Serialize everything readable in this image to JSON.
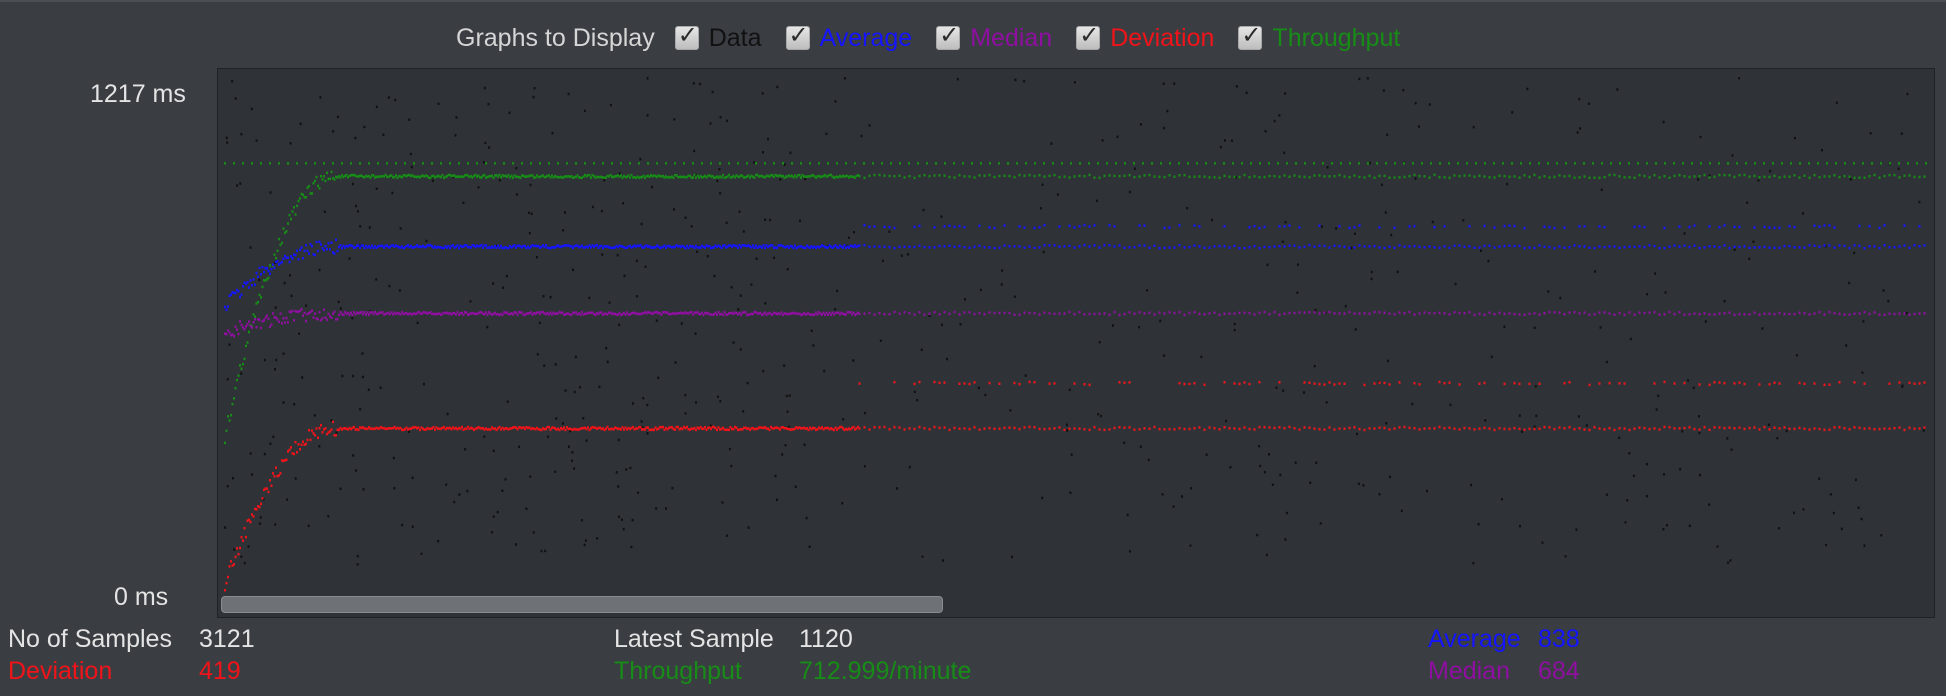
{
  "controls": {
    "title": "Graphs to Display",
    "checkboxes": [
      {
        "label": "Data",
        "checked": true,
        "color": "#111111"
      },
      {
        "label": "Average",
        "checked": true,
        "color": "#1414ff"
      },
      {
        "label": "Median",
        "checked": true,
        "color": "#8e0fa0"
      },
      {
        "label": "Deviation",
        "checked": true,
        "color": "#f0141a"
      },
      {
        "label": "Throughput",
        "checked": true,
        "color": "#178c17"
      }
    ]
  },
  "y_axis": {
    "max_label": "1217  ms",
    "min_label": "0  ms"
  },
  "chart_data": {
    "type": "scatter",
    "title": "",
    "ylabel": "ms",
    "ylim": [
      0,
      1217
    ],
    "series": [
      {
        "name": "Data",
        "color": "#111111"
      },
      {
        "name": "Average",
        "color": "#1414ff",
        "settled_value": 838
      },
      {
        "name": "Median",
        "color": "#8e0fa0",
        "settled_value": 684
      },
      {
        "name": "Deviation",
        "color": "#f0141a",
        "settled_value": 419
      },
      {
        "name": "Throughput",
        "color": "#178c17"
      }
    ]
  },
  "stats": {
    "samples_label": "No of Samples",
    "samples_value": "3121",
    "latest_label": "Latest Sample",
    "latest_value": "1120",
    "average_label": "Average",
    "average_value": "838",
    "deviation_label": "Deviation",
    "deviation_value": "419",
    "throughput_label": "Throughput",
    "throughput_value": "712.999/minute",
    "median_label": "Median",
    "median_value": "684"
  },
  "colors": {
    "average": "#1414ff",
    "median": "#8e0fa0",
    "deviation": "#f0141a",
    "throughput": "#178c17",
    "data": "#111111",
    "text": "#e4e4e4"
  }
}
